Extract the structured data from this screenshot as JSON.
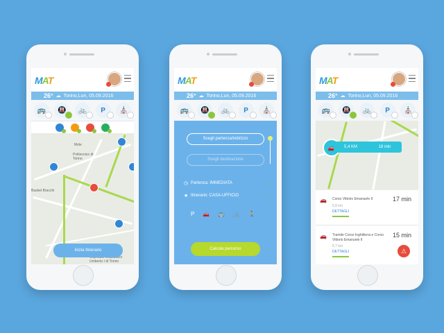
{
  "app": {
    "logo_m": "M",
    "logo_a": "A",
    "logo_t": "T"
  },
  "header": {
    "temp": "26°",
    "date_p1": "Torino,Lun, 05.09.2016",
    "date_p2": "Torino,Lun, 05.09.2016",
    "date_p3": "Torino,Lun, 05.09.2016"
  },
  "modes": {
    "bus": "🚌",
    "metro": "🚇",
    "bike": "🚲",
    "parking": "P",
    "monument": "⛪"
  },
  "screen1": {
    "map_labels": {
      "mole": "Mole",
      "politecnico": "Politecnico di Torino",
      "basket": "Basket Bracchi",
      "corso": "Corso Duca degli Abruzzi",
      "ospedale": "Ospedale Mauriziano Umberto I di Torino"
    },
    "start_button": "Inizia Itinerario"
  },
  "screen2": {
    "start_field": "Scegli partenza/indirizzo",
    "dest_field": "Scegli destinazione",
    "departure": "Partenza: IMMEDIATA",
    "itinerary": "Itinerario: CASA-UFFICIO",
    "calc_button": "Calcola percorso",
    "transports": [
      "P",
      "🚗",
      "🚌",
      "🚲",
      "🚶"
    ]
  },
  "screen3": {
    "distance": "5,4 KM",
    "duration": "18 min",
    "routes": [
      {
        "title": "Corso Vittorio Emanuele II",
        "km": "5,8 km",
        "details": "DETTAGLI",
        "time": "17 min"
      },
      {
        "title": "Tramite Corso Inghilterra e Corso Vittorio Emanuele II",
        "km": "5,7 km",
        "details": "DETTAGLI",
        "time": "15 min"
      }
    ]
  },
  "colors": {
    "background": "#5aa6de",
    "accent_green": "#8cc63f",
    "accent_blue": "#2f86d6",
    "header_blue": "#7cbdea"
  }
}
